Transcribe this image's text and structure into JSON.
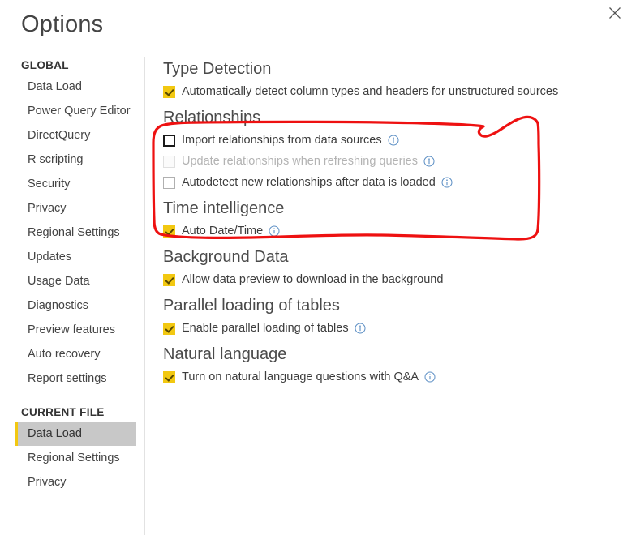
{
  "window": {
    "title": "Options",
    "close_label": "Close",
    "close_icon": "close-icon"
  },
  "sidebar": {
    "groups": [
      {
        "title": "GLOBAL",
        "items": [
          {
            "label": "Data Load",
            "selected": false
          },
          {
            "label": "Power Query Editor",
            "selected": false
          },
          {
            "label": "DirectQuery",
            "selected": false
          },
          {
            "label": "R scripting",
            "selected": false
          },
          {
            "label": "Security",
            "selected": false
          },
          {
            "label": "Privacy",
            "selected": false
          },
          {
            "label": "Regional Settings",
            "selected": false
          },
          {
            "label": "Updates",
            "selected": false
          },
          {
            "label": "Usage Data",
            "selected": false
          },
          {
            "label": "Diagnostics",
            "selected": false
          },
          {
            "label": "Preview features",
            "selected": false
          },
          {
            "label": "Auto recovery",
            "selected": false
          },
          {
            "label": "Report settings",
            "selected": false
          }
        ]
      },
      {
        "title": "CURRENT FILE",
        "items": [
          {
            "label": "Data Load",
            "selected": true
          },
          {
            "label": "Regional Settings",
            "selected": false
          },
          {
            "label": "Privacy",
            "selected": false
          }
        ]
      }
    ]
  },
  "main": {
    "sections": [
      {
        "heading": "Type Detection",
        "options": [
          {
            "label": "Automatically detect column types and headers for unstructured sources",
            "state": "checked",
            "info": false
          }
        ]
      },
      {
        "heading": "Relationships",
        "options": [
          {
            "label": "Import relationships from data sources",
            "state": "unchecked-focused",
            "info": true
          },
          {
            "label": "Update relationships when refreshing queries",
            "state": "unchecked-disabled",
            "info": true
          },
          {
            "label": "Autodetect new relationships after data is loaded",
            "state": "unchecked",
            "info": true
          }
        ]
      },
      {
        "heading": "Time intelligence",
        "options": [
          {
            "label": "Auto Date/Time",
            "state": "checked",
            "info": true
          }
        ]
      },
      {
        "heading": "Background Data",
        "options": [
          {
            "label": "Allow data preview to download in the background",
            "state": "checked",
            "info": false
          }
        ]
      },
      {
        "heading": "Parallel loading of tables",
        "options": [
          {
            "label": "Enable parallel loading of tables",
            "state": "checked",
            "info": true
          }
        ]
      },
      {
        "heading": "Natural language",
        "options": [
          {
            "label": "Turn on natural language questions with Q&A",
            "state": "checked",
            "info": true
          }
        ]
      }
    ]
  },
  "annotation": {
    "kind": "hand-drawn-red-loop",
    "color": "#ee1111",
    "encloses_section": "Relationships"
  },
  "colors": {
    "accent_yellow": "#f2c811",
    "selected_row_bg": "#c8c8c8",
    "annotation_red": "#ee1111",
    "info_blue": "#5b8ec4",
    "heading_gray": "#4a4a4a"
  }
}
